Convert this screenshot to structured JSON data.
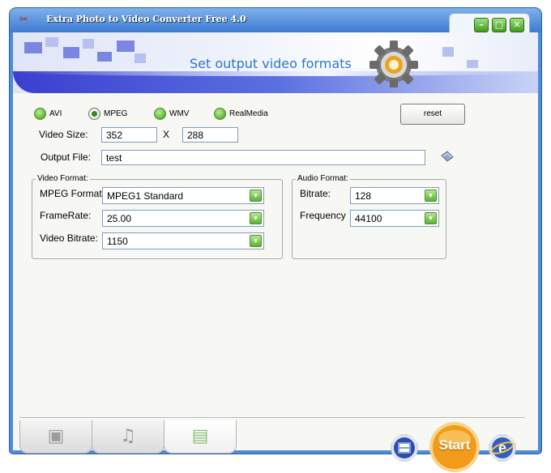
{
  "window": {
    "title": "Extra Photo to Video Converter Free 4.0"
  },
  "titlebar_buttons": {
    "minimize": "–",
    "maximize": "□",
    "close": "✕"
  },
  "banner": {
    "heading": "Set output video formats"
  },
  "formats": [
    {
      "label": "AVI",
      "selected": false
    },
    {
      "label": "MPEG",
      "selected": true
    },
    {
      "label": "WMV",
      "selected": false
    },
    {
      "label": "RealMedia",
      "selected": false
    }
  ],
  "reset_label": "reset",
  "video_size": {
    "label": "Video Size:",
    "width": "352",
    "separator": "X",
    "height": "288"
  },
  "output_file": {
    "label": "Output File:",
    "value": "test"
  },
  "video_format": {
    "title": "Video Format:",
    "mpeg_format": {
      "label": "MPEG Format",
      "value": "MPEG1 Standard"
    },
    "frame_rate": {
      "label": "FrameRate:",
      "value": "25.00"
    },
    "video_bitrate": {
      "label": "Video Bitrate:",
      "value": "1150"
    }
  },
  "audio_format": {
    "title": "Audio Format:",
    "bitrate": {
      "label": "Bitrate:",
      "value": "128"
    },
    "frequency": {
      "label": "Frequency",
      "value": "44100"
    }
  },
  "start_label": "Start",
  "icons": {
    "app": "app-logo-icon",
    "gear": "gear-icon",
    "folder": "browse-folder-icon",
    "tab1": "photos-icon",
    "tab2": "music-icon",
    "tab3": "video-output-icon",
    "film": "film-icon",
    "web": "web-icon"
  },
  "colors": {
    "accent_green": "#3d9a1a",
    "title_blue": "#2b78c9",
    "start_orange": "#f29a1a"
  }
}
